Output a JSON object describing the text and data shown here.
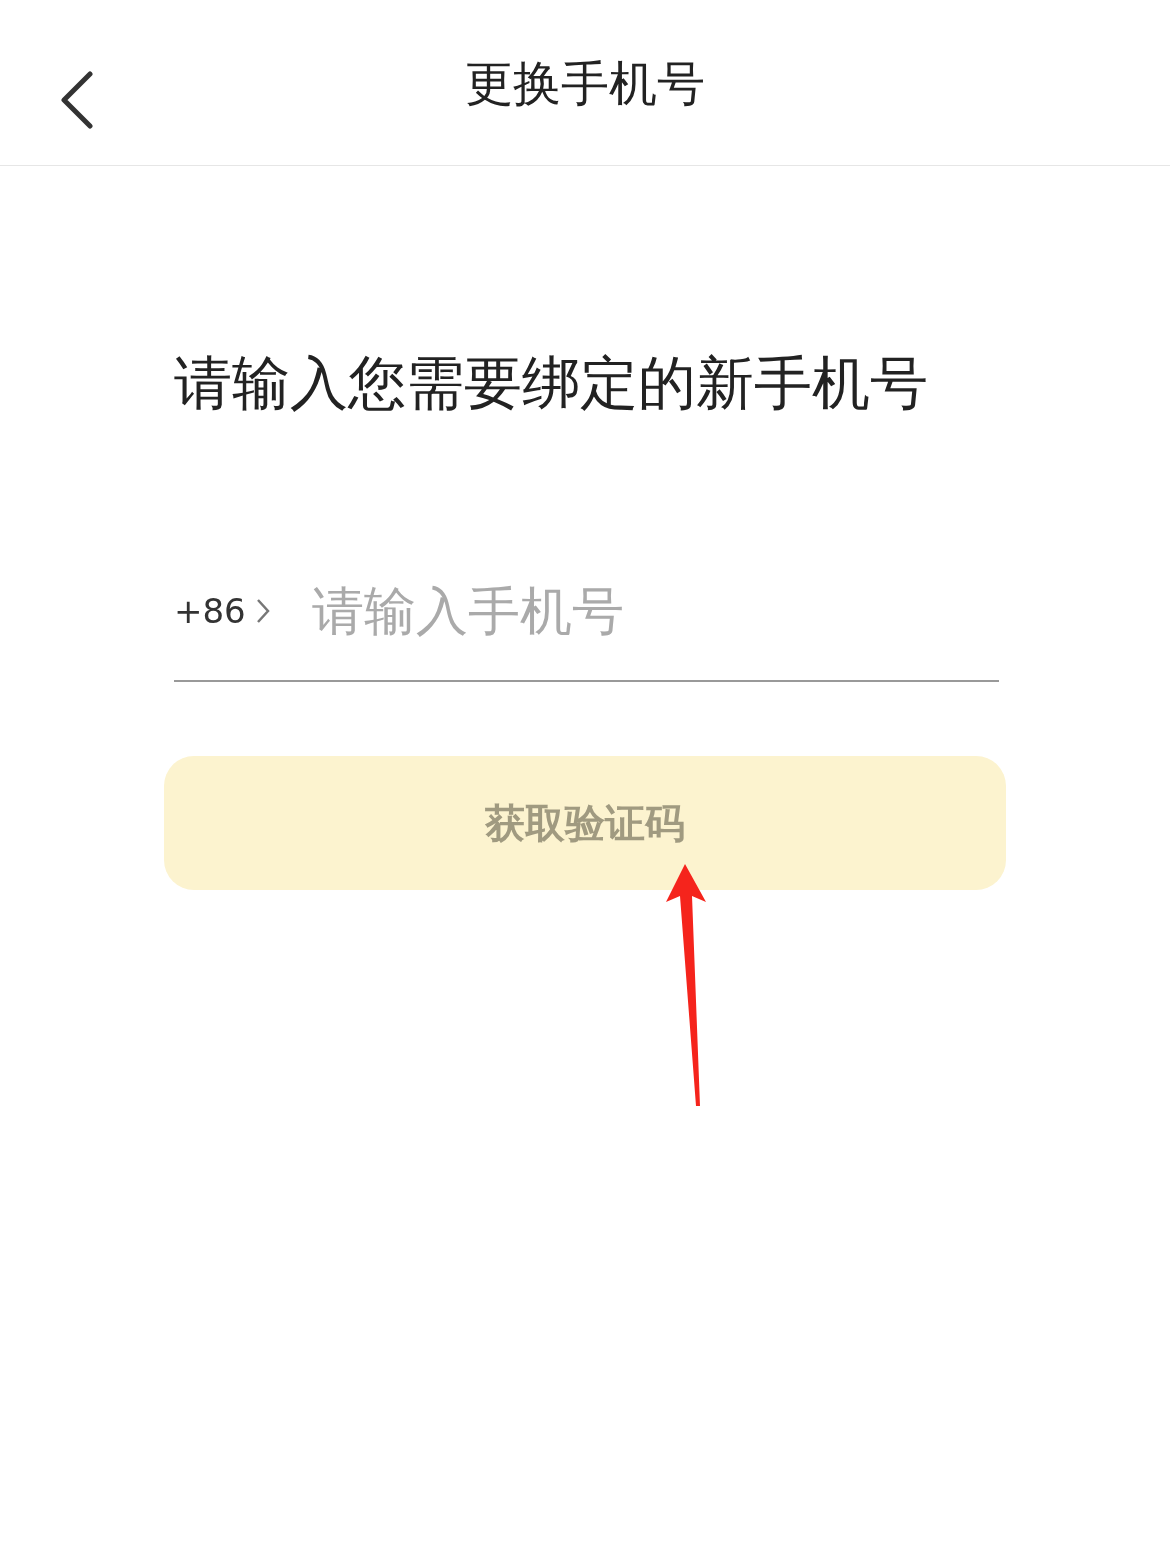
{
  "header": {
    "title": "更换手机号"
  },
  "prompt": "请输入您需要绑定的新手机号",
  "phone": {
    "country_code": "+86",
    "placeholder": "请输入手机号"
  },
  "submit": {
    "label": "获取验证码",
    "disabled": true
  }
}
